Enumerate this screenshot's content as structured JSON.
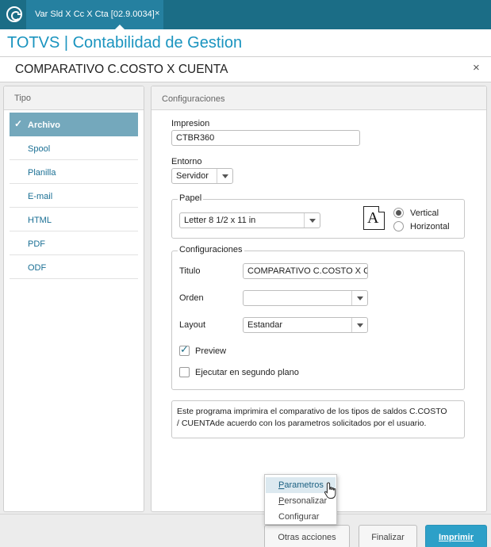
{
  "tab": {
    "label": "Var Sld X Cc X Cta [02.9.0034]",
    "close": "×"
  },
  "app": {
    "title": "TOTVS | Contabilidad de Gestion"
  },
  "dialog": {
    "title": "COMPARATIVO C.COSTO X CUENTA",
    "close": "×"
  },
  "tipo": {
    "header": "Tipo",
    "items": [
      {
        "label": "Archivo",
        "selected": true
      },
      {
        "label": "Spool"
      },
      {
        "label": "Planilla"
      },
      {
        "label": "E-mail"
      },
      {
        "label": "HTML"
      },
      {
        "label": "PDF"
      },
      {
        "label": "ODF"
      }
    ],
    "check": "✓"
  },
  "config": {
    "header": "Configuraciones",
    "impresion": {
      "label": "Impresion",
      "value": "CTBR360"
    },
    "entorno": {
      "label": "Entorno",
      "value": "Servidor"
    },
    "papel": {
      "legend": "Papel",
      "value": "Letter 8 1/2 x 11 in",
      "orientation_icon_letter": "A",
      "vertical": "Vertical",
      "horizontal": "Horizontal",
      "selected": "Vertical"
    },
    "group": {
      "legend": "Configuraciones",
      "titulo": {
        "label": "Titulo",
        "value": "COMPARATIVO C.COSTO X CU"
      },
      "orden": {
        "label": "Orden",
        "value": ""
      },
      "layout": {
        "label": "Layout",
        "value": "Estandar"
      },
      "preview": {
        "label": "Preview",
        "checked": true
      },
      "segundo_plano": {
        "label": "Ejecutar en segundo plano",
        "checked": false
      }
    },
    "description_line1": "Este programa imprimira el comparativo de los tipos de saldos C.COSTO",
    "description_line2": "/ CUENTAde acuerdo con los parametros solicitados por el usuario."
  },
  "footer": {
    "otras": "Otras acciones",
    "finalizar": "Finalizar",
    "imprimir": "Imprimir"
  },
  "menu": {
    "parametros_first": "P",
    "parametros_rest": "arametros",
    "personalizar_first": "P",
    "personalizar_rest": "ersonalizar",
    "configurar": "Configurar"
  },
  "colors": {
    "topbar": "#1b6d86",
    "accent": "#2da0c8",
    "title": "#1a94bf",
    "selected": "#74a8bc"
  }
}
